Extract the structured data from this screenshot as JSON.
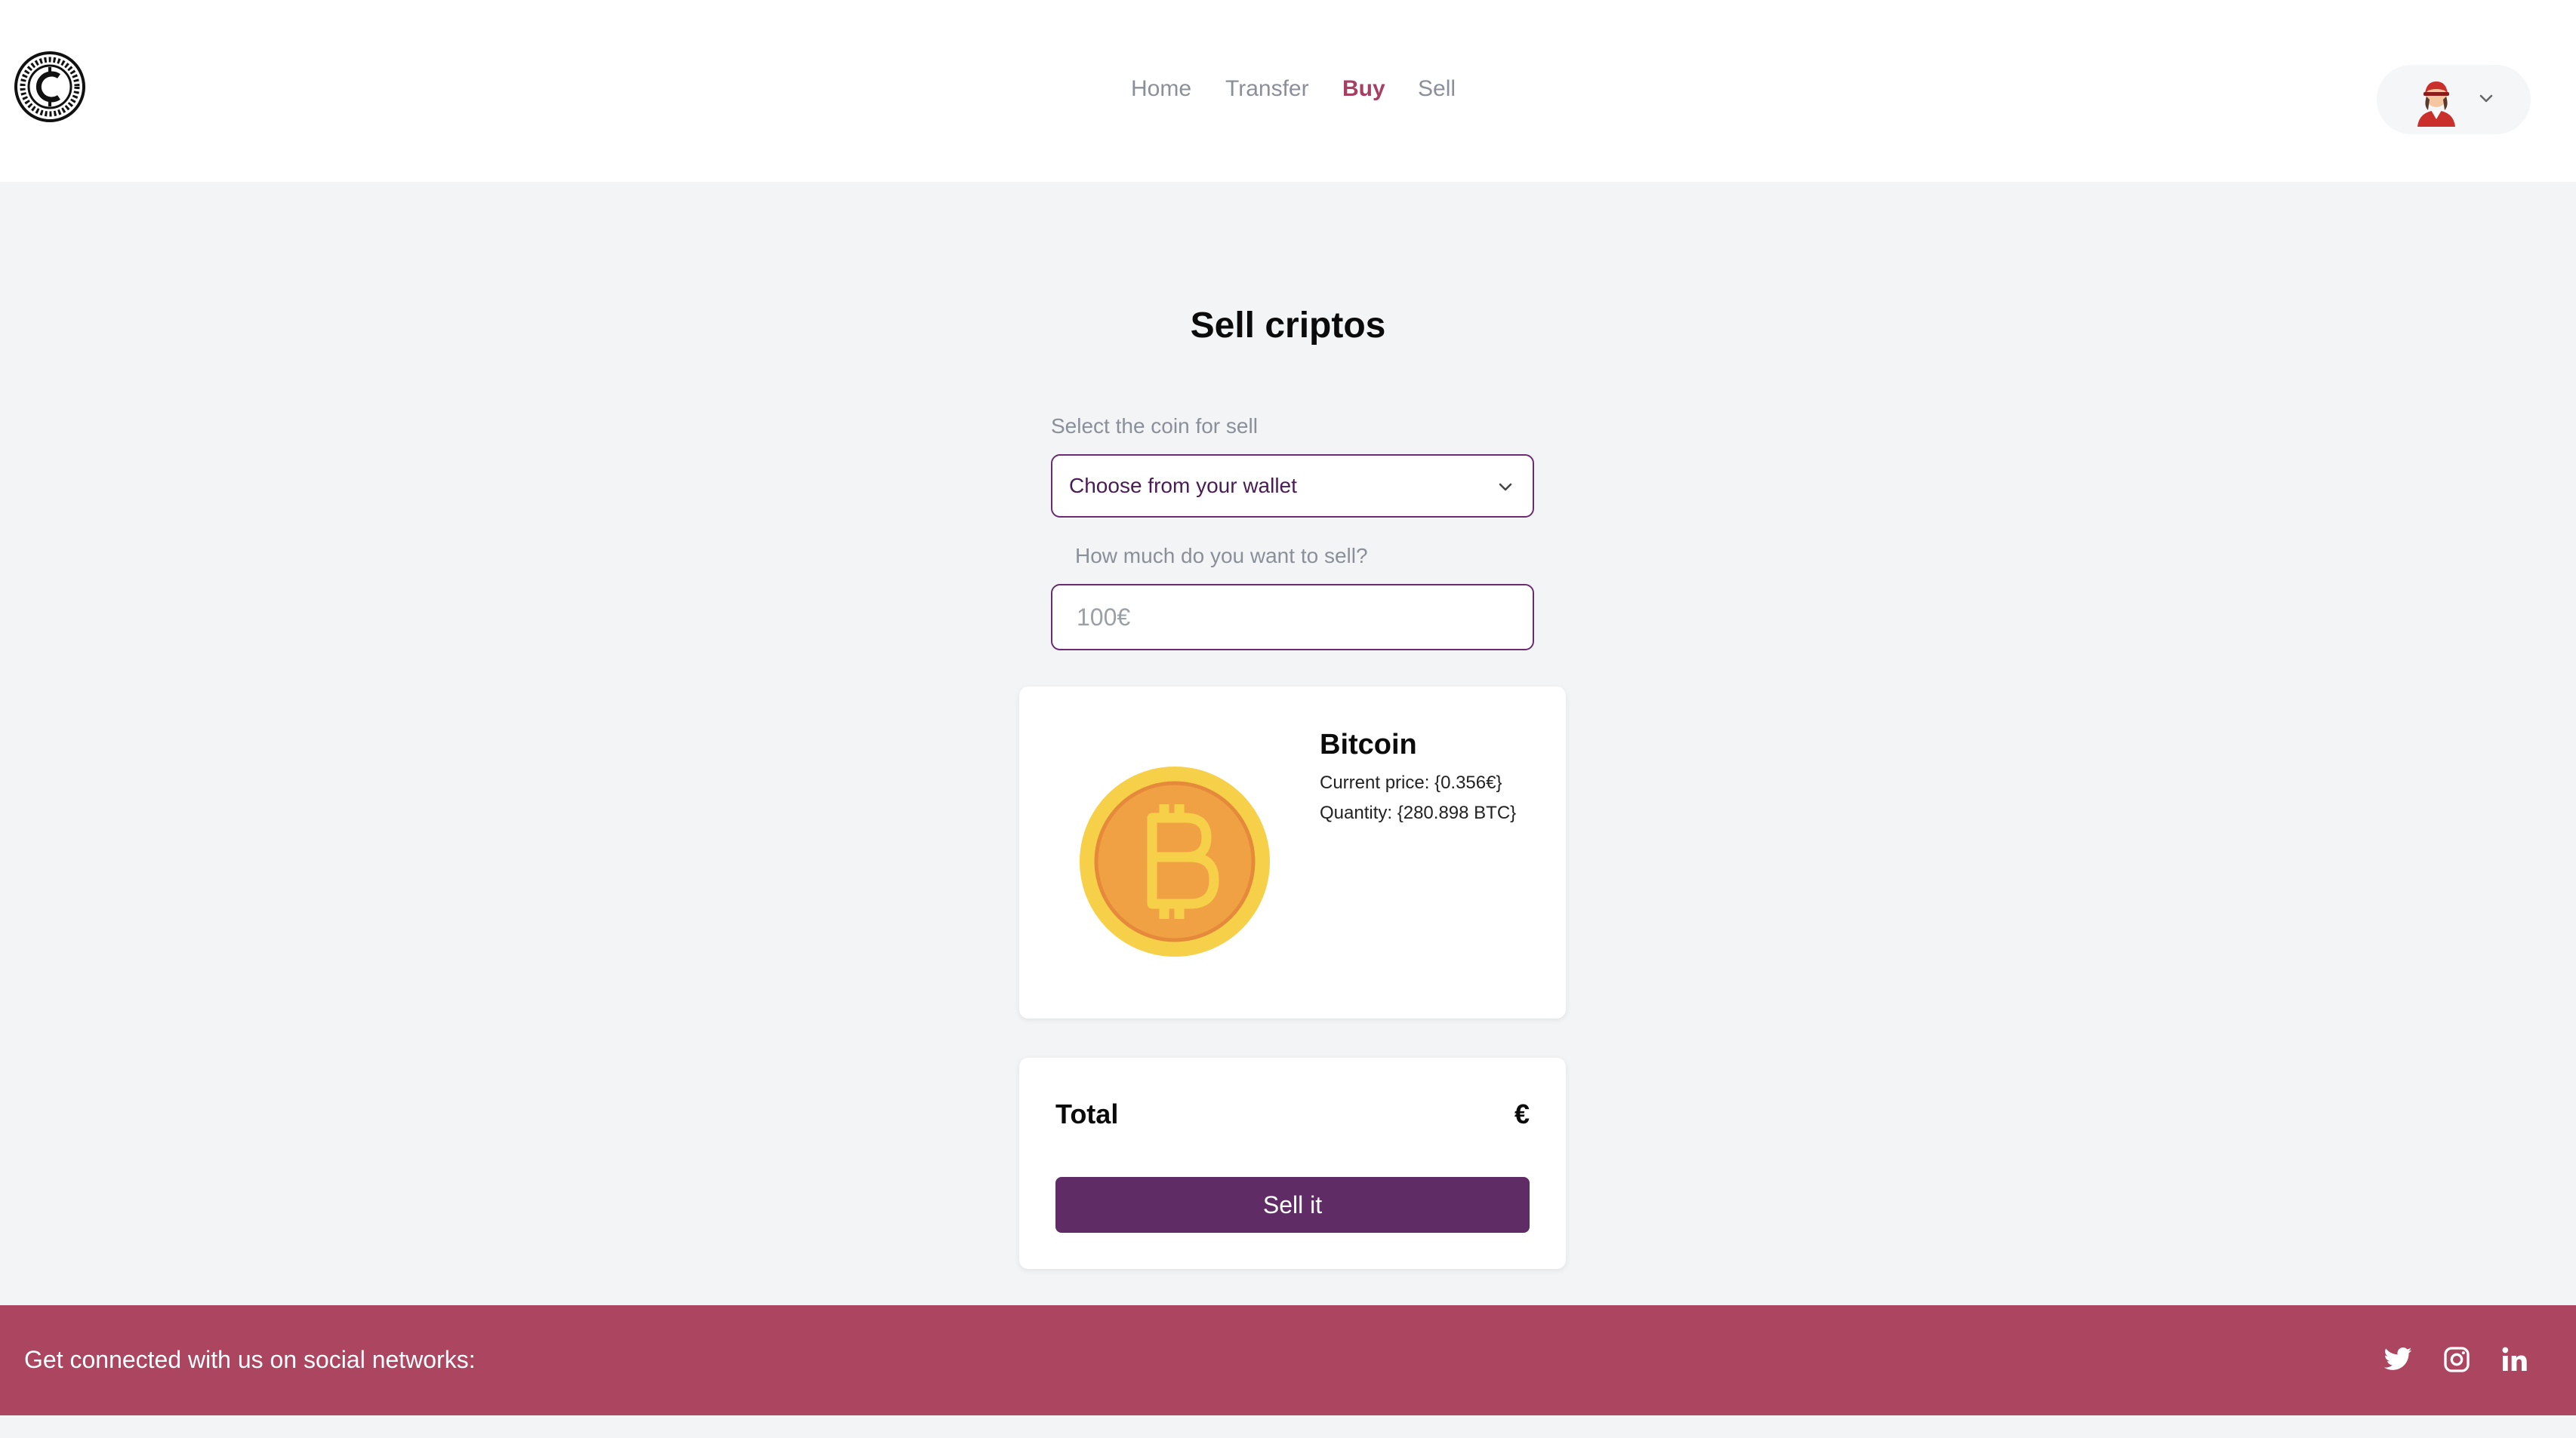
{
  "nav": {
    "links": [
      {
        "label": "Home",
        "active": false
      },
      {
        "label": "Transfer",
        "active": false
      },
      {
        "label": "Buy",
        "active": true
      },
      {
        "label": "Sell",
        "active": false
      }
    ]
  },
  "user_menu": {
    "avatar_icon": "avatar-icon",
    "chevron_icon": "chevron-down-icon"
  },
  "main": {
    "title": "Sell criptos",
    "coin_select": {
      "label": "Select the coin for sell",
      "value": "Choose from your wallet"
    },
    "amount": {
      "label": "How much do you want to sell?",
      "placeholder": "100€",
      "value": ""
    }
  },
  "coin_card": {
    "name": "Bitcoin",
    "current_price": "Current price: {0.356€}",
    "quantity": "Quantity: {280.898 BTC}",
    "icon": "bitcoin-icon"
  },
  "total_card": {
    "label": "Total",
    "value": "€",
    "button_label": "Sell it"
  },
  "footer": {
    "text": "Get connected with us on social networks:",
    "social": [
      "twitter-icon",
      "instagram-icon",
      "linkedin-icon"
    ]
  },
  "colors": {
    "accent": "#a83f62",
    "primary_button": "#5f2c66",
    "input_border": "#6a2c70",
    "footer_bg": "#ab4560",
    "page_bg": "#f3f4f6"
  }
}
